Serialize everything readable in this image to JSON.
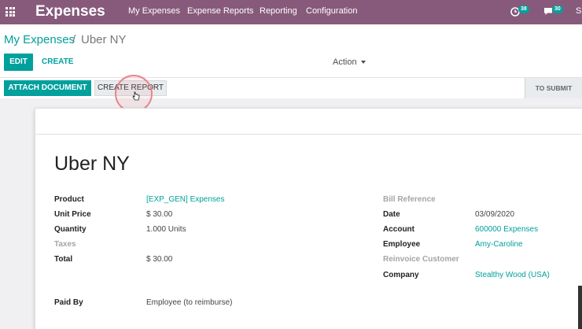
{
  "navbar": {
    "app_title": "Expenses",
    "menu": [
      "My Expenses",
      "Expense Reports",
      "Reporting",
      "Configuration"
    ],
    "activity_badge": "38",
    "messages_badge": "30",
    "user_initial": "S",
    "colors": {
      "bar": "#875a7b",
      "badge": "#00a09d"
    }
  },
  "breadcrumb": {
    "parent": "My Expenses",
    "separator": "/",
    "current": "Uber NY"
  },
  "control": {
    "edit": "EDIT",
    "create": "CREATE",
    "action": "Action"
  },
  "statusbar": {
    "attach": "ATTACH DOCUMENT",
    "create_report": "CREATE REPORT",
    "stage": "TO SUBMIT"
  },
  "form": {
    "title": "Uber NY",
    "left": [
      {
        "label": "Product",
        "value": "[EXP_GEN] Expenses"
      },
      {
        "label": "Unit Price",
        "value": "$ 30.00"
      },
      {
        "label": "Quantity",
        "value": "1.000 Units"
      },
      {
        "label": "Taxes",
        "value": ""
      },
      {
        "label": "Total",
        "value": "$ 30.00"
      }
    ],
    "right": [
      {
        "label": "Bill Reference",
        "value": ""
      },
      {
        "label": "Date",
        "value": "03/09/2020"
      },
      {
        "label": "Account",
        "value": "600000 Expenses"
      },
      {
        "label": "Employee",
        "value": "Amy-Caroline"
      },
      {
        "label": "Reinvoice Customer",
        "value": ""
      },
      {
        "label": "Company",
        "value": "Stealthy Wood (USA)"
      }
    ],
    "paid_by": {
      "label": "Paid By",
      "value": "Employee (to reimburse)"
    }
  },
  "accent_color": "#00a09d"
}
